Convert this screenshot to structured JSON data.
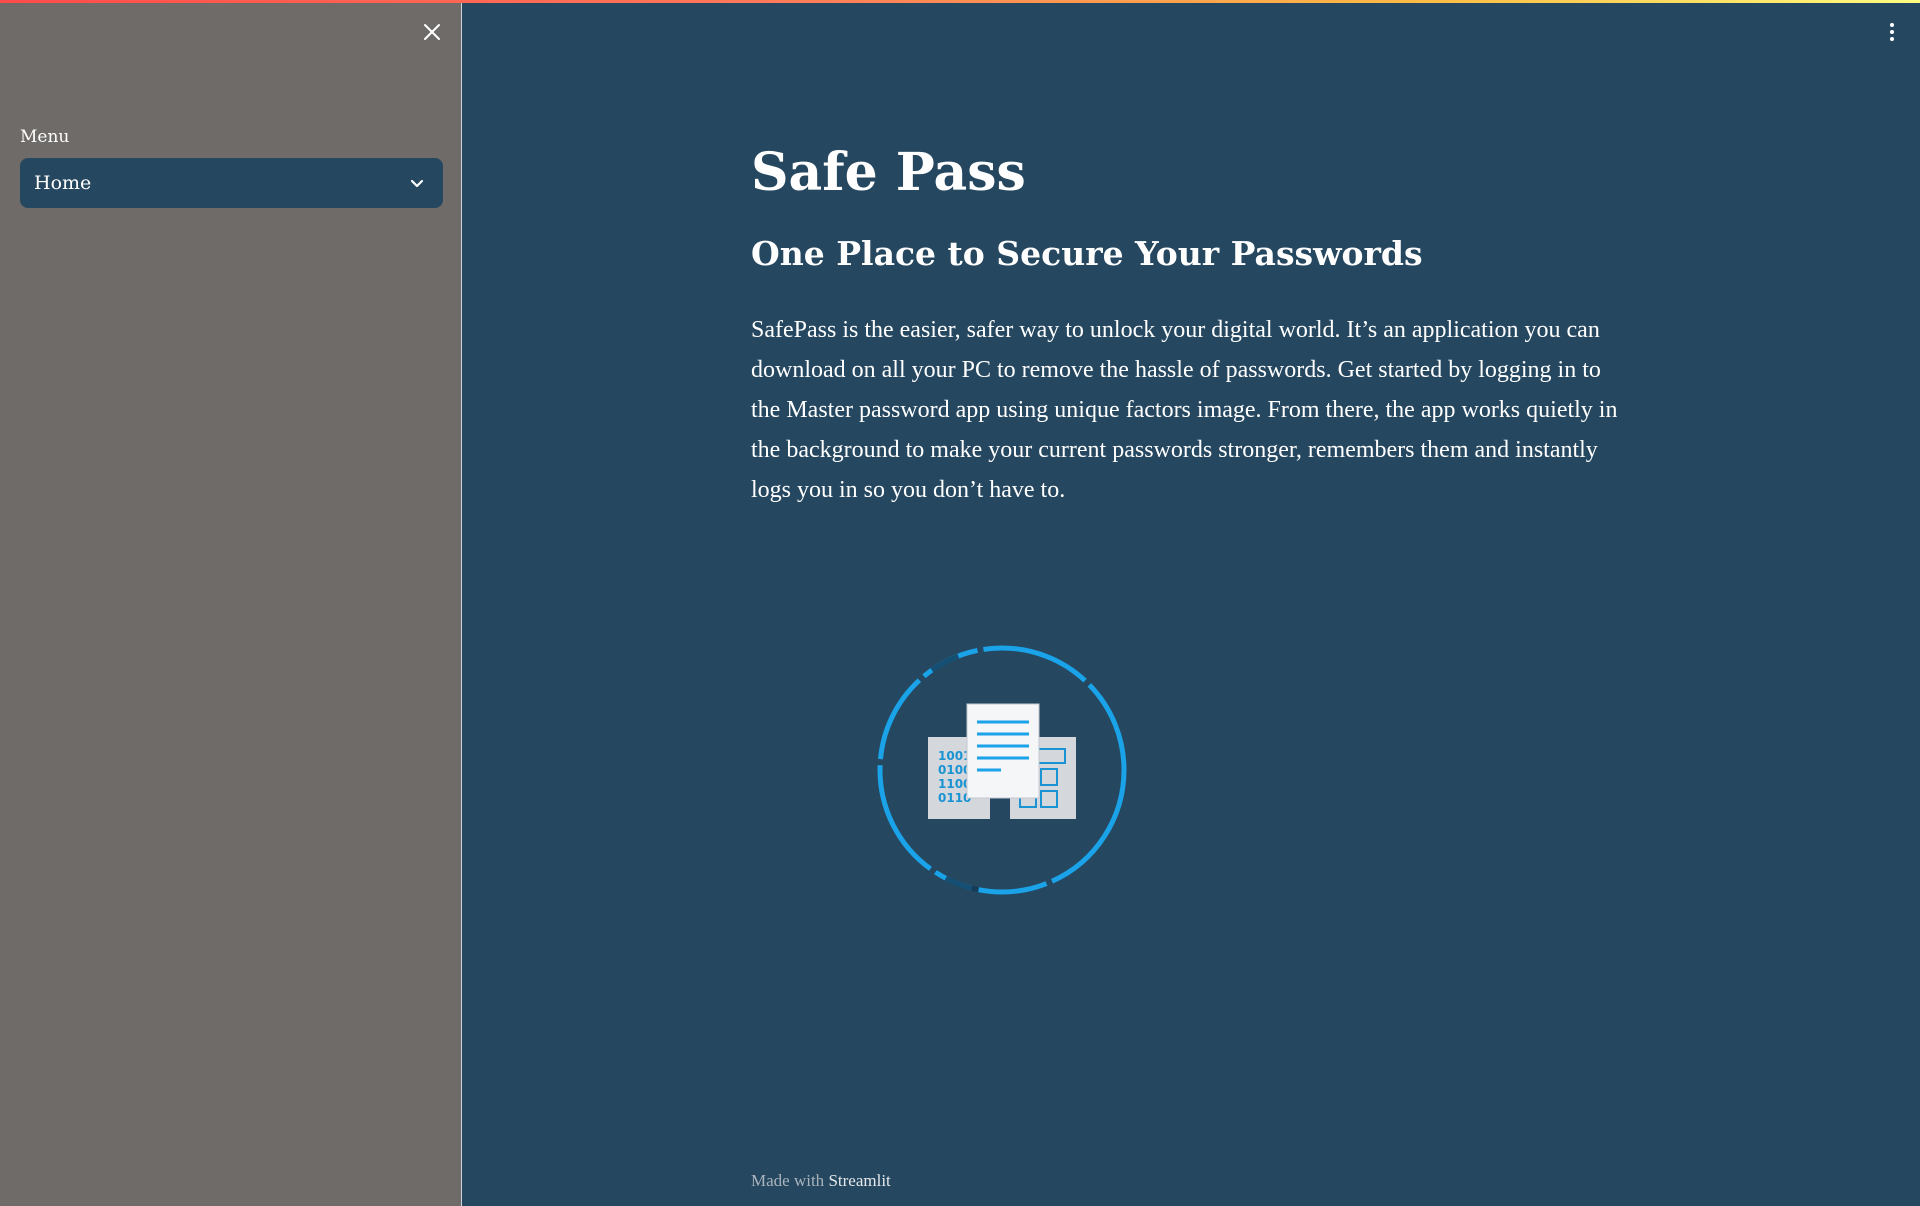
{
  "sidebar": {
    "close_icon": "close-icon",
    "menu_label": "Menu",
    "menu_selected": "Home",
    "chevron_icon": "chevron-down-icon"
  },
  "header": {
    "more_icon": "kebab-menu-icon"
  },
  "main": {
    "title": "Safe Pass",
    "subtitle": "One Place to Secure Your Passwords",
    "description": "SafePass is the easier, safer way to unlock your digital world. It’s an application you can download on all your PC to remove the hassle of passwords. Get started by logging in to the Master password app using unique factors image. From there, the app works quietly in the background to make your current passwords stronger, remembers them and instantly logs you in so you don’t have to.",
    "illustration": {
      "icon": "document-sync-loading-icon",
      "binary_lines": [
        "1001",
        "0100",
        "1100",
        "0110"
      ]
    }
  },
  "footer": {
    "prefix": "Made with",
    "brand": "Streamlit"
  },
  "colors": {
    "main_bg": "#25475f",
    "sidebar_bg": "#6e6b69",
    "accent": "#1aa3e8"
  }
}
